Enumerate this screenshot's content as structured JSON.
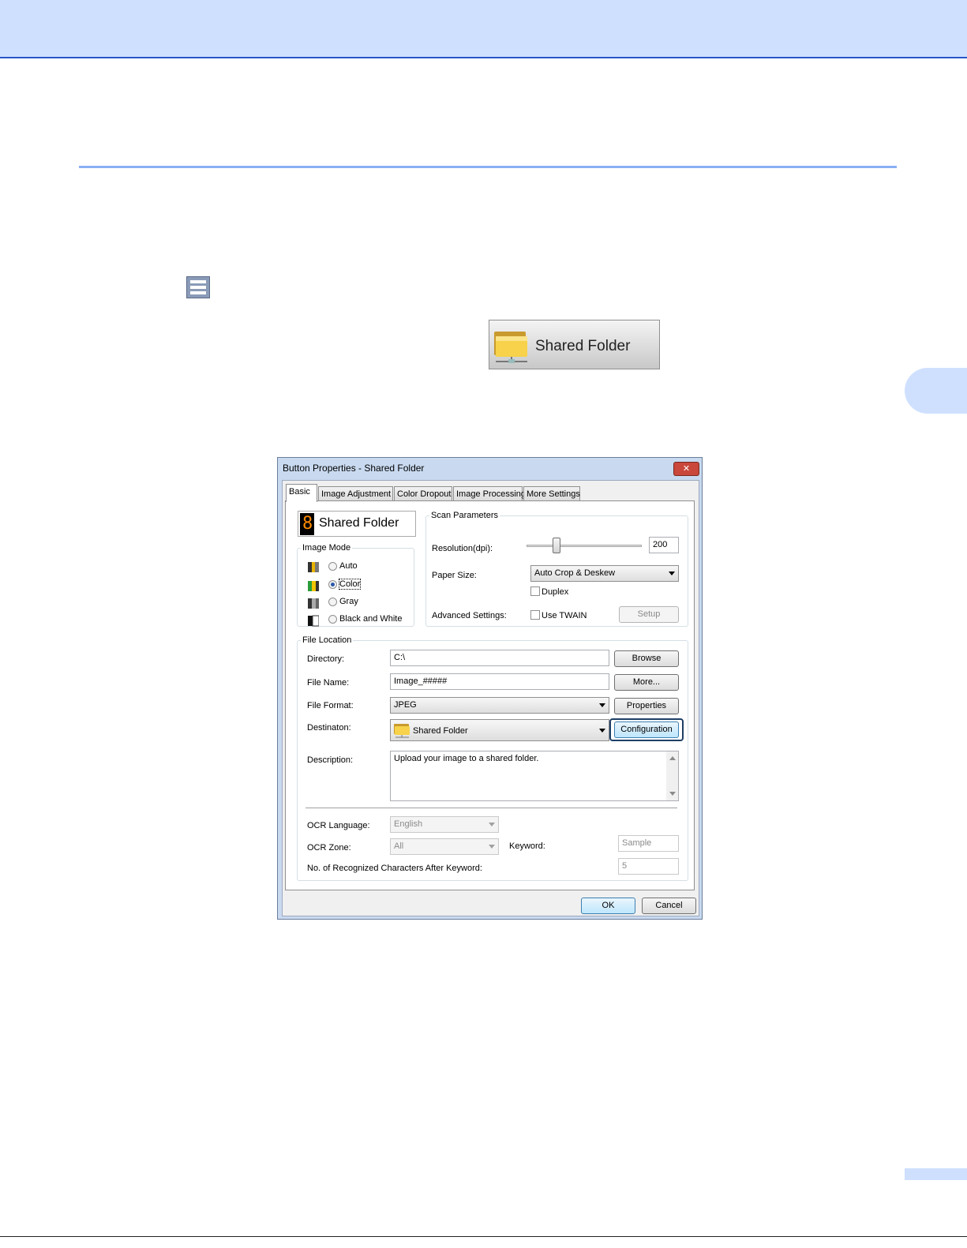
{
  "shared_folder_button": {
    "label": "Shared Folder"
  },
  "dialog": {
    "title": "Button Properties - Shared Folder",
    "close_label": "✕",
    "tabs": [
      "Basic",
      "Image Adjustment",
      "Color Dropout",
      "Image Processing",
      "More Settings"
    ],
    "active_tab": "Basic",
    "button_digit": "8",
    "button_name": "Shared Folder",
    "image_mode": {
      "legend": "Image Mode",
      "options": [
        "Auto",
        "Color",
        "Gray",
        "Black and White"
      ],
      "selected": "Color"
    },
    "scan_parameters": {
      "legend": "Scan Parameters",
      "resolution_label": "Resolution(dpi):",
      "resolution_value": "200",
      "paper_size_label": "Paper Size:",
      "paper_size_value": "Auto Crop & Deskew",
      "duplex_label": "Duplex",
      "advanced_label": "Advanced Settings:",
      "use_twain_label": "Use TWAIN",
      "setup_label": "Setup"
    },
    "file_location": {
      "legend": "File Location",
      "directory_label": "Directory:",
      "directory_value": "C:\\",
      "browse_label": "Browse",
      "file_name_label": "File Name:",
      "file_name_value": "Image_#####",
      "more_label": "More...",
      "file_format_label": "File Format:",
      "file_format_value": "JPEG",
      "properties_label": "Properties",
      "destination_label": "Destinaton:",
      "destination_value": "Shared Folder",
      "configuration_label": "Configuration",
      "description_label": "Description:",
      "description_value": "Upload your image to a shared folder.",
      "ocr_language_label": "OCR Language:",
      "ocr_language_value": "English",
      "ocr_zone_label": "OCR Zone:",
      "ocr_zone_value": "All",
      "keyword_label": "Keyword:",
      "keyword_value": "Sample",
      "recognized_chars_label": "No. of Recognized Characters After Keyword:",
      "recognized_chars_value": "5"
    },
    "ok_label": "OK",
    "cancel_label": "Cancel"
  },
  "colors": {
    "header_band": "#cfe0ff",
    "rule": "#8ab0f5",
    "highlight_ring": "#1e3f66"
  }
}
